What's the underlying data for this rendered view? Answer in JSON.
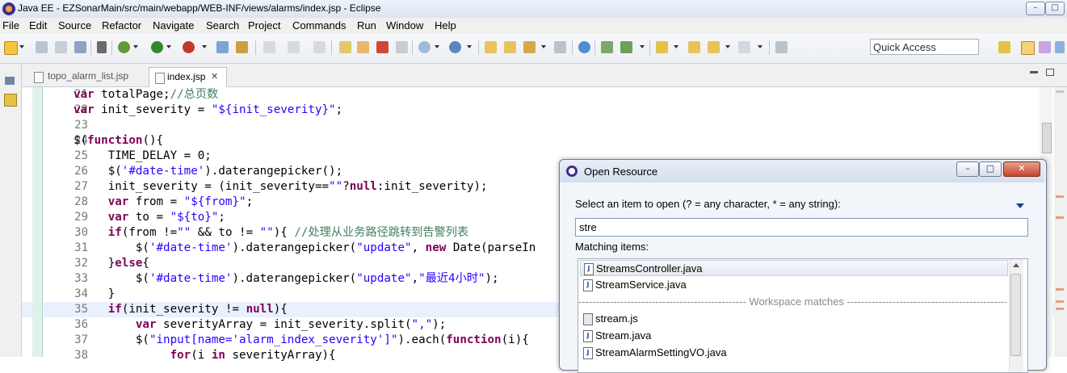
{
  "window": {
    "title": "Java EE - EZSonarMain/src/main/webapp/WEB-INF/views/alarms/index.jsp - Eclipse",
    "minimize_glyph": "–",
    "maximize_glyph": "□"
  },
  "menu": [
    "File",
    "Edit",
    "Source",
    "Refactor",
    "Navigate",
    "Search",
    "Project",
    "Commands",
    "Run",
    "Window",
    "Help"
  ],
  "toolbar": {
    "quick_access_placeholder": "Quick Access"
  },
  "tabs": [
    {
      "label": "topo_alarm_list.jsp",
      "active": false
    },
    {
      "label": "index.jsp",
      "active": true,
      "close_glyph": "✕"
    }
  ],
  "editor": {
    "lines": [
      {
        "n": "21",
        "html": "<span class=\"kw\">var</span> totalPage;<span class=\"cmt\">//总页数</span>"
      },
      {
        "n": "22",
        "html": "<span class=\"kw\">var</span> init_severity = <span class=\"str\">\"${init_severity}\"</span>;"
      },
      {
        "n": "23",
        "html": ""
      },
      {
        "n": "24",
        "html": "$(<span class=\"kw\">function</span>(){"
      },
      {
        "n": "25",
        "html": "     TIME_DELAY = 0;"
      },
      {
        "n": "26",
        "html": "     $(<span class=\"str\">'#date-time'</span>).daterangepicker();"
      },
      {
        "n": "27",
        "html": "     init_severity = (init_severity==<span class=\"str\">\"\"</span>?<span class=\"kw\">null</span>:init_severity);"
      },
      {
        "n": "28",
        "html": "     <span class=\"kw\">var</span> from = <span class=\"str\">\"${from}\"</span>;"
      },
      {
        "n": "29",
        "html": "     <span class=\"kw\">var</span> to = <span class=\"str\">\"${to}\"</span>;"
      },
      {
        "n": "30",
        "html": "     <span class=\"kw\">if</span>(from !=<span class=\"str\">\"\"</span> &amp;&amp; to != <span class=\"str\">\"\"</span>){ <span class=\"cmt\">//处理从业务路径跳转到告警列表</span>"
      },
      {
        "n": "31",
        "html": "         $(<span class=\"str\">'#date-time'</span>).daterangepicker(<span class=\"str\">\"update\"</span>, <span class=\"kw\">new</span> Date(parseIn"
      },
      {
        "n": "32",
        "html": "     }<span class=\"kw\">else</span>{"
      },
      {
        "n": "33",
        "html": "         $(<span class=\"str\">'#date-time'</span>).daterangepicker(<span class=\"str\">\"update\"</span>,<span class=\"str\">\"最近4小时\"</span>);"
      },
      {
        "n": "34",
        "html": "     }"
      },
      {
        "n": "35",
        "html": "     <span class=\"kw\">if</span>(init_severity != <span class=\"kw\">null</span>){",
        "highlight": true
      },
      {
        "n": "36",
        "html": "         <span class=\"kw\">var</span> severityArray = init_severity.split(<span class=\"str\">\",\"</span>);"
      },
      {
        "n": "37",
        "html": "         $(<span class=\"str\">\"input[name='alarm_index_severity']\"</span>).each(<span class=\"kw\">function</span>(i){"
      },
      {
        "n": "38",
        "html": "              <span class=\"kw\">for</span>(i <span class=\"kw\">in</span> severityArray){"
      }
    ]
  },
  "dialog": {
    "title": "Open Resource",
    "prompt": "Select an item to open (? = any character, * = any string):",
    "search_value": "stre",
    "matching_label": "Matching items:",
    "buttons": {
      "minimize": "–",
      "maximize": "□",
      "close": "✕"
    },
    "items": [
      {
        "kind": "java",
        "label": "StreamsController.java",
        "selected": true
      },
      {
        "kind": "java",
        "label": "StreamService.java"
      },
      {
        "kind": "separator",
        "label": "------------------------------------------------ Workspace matches ------------------------------------------------"
      },
      {
        "kind": "js",
        "label": "stream.js"
      },
      {
        "kind": "java",
        "label": "Stream.java"
      },
      {
        "kind": "java",
        "label": "StreamAlarmSettingVO.java"
      }
    ]
  },
  "colors": {
    "keyword": "#7f0055",
    "string": "#2a00ff",
    "comment": "#3f7f5f",
    "line_highlight": "#e8f2fe"
  }
}
